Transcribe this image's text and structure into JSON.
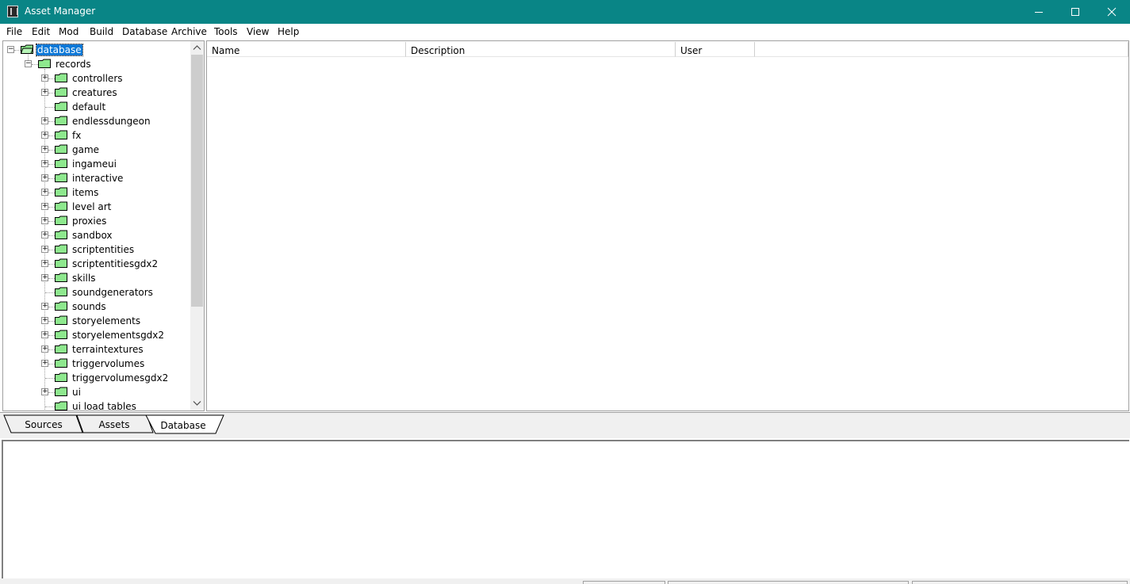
{
  "window": {
    "title": "Asset Manager"
  },
  "menu": [
    "File",
    "Edit",
    "Mod",
    "Build",
    "Database",
    "Archive",
    "Tools",
    "View",
    "Help"
  ],
  "tree": {
    "root": "database",
    "records": "records",
    "children": [
      {
        "label": "controllers",
        "expandable": true
      },
      {
        "label": "creatures",
        "expandable": true
      },
      {
        "label": "default",
        "expandable": false
      },
      {
        "label": "endlessdungeon",
        "expandable": true
      },
      {
        "label": "fx",
        "expandable": true
      },
      {
        "label": "game",
        "expandable": true
      },
      {
        "label": "ingameui",
        "expandable": true
      },
      {
        "label": "interactive",
        "expandable": true
      },
      {
        "label": "items",
        "expandable": true
      },
      {
        "label": "level art",
        "expandable": true
      },
      {
        "label": "proxies",
        "expandable": true
      },
      {
        "label": "sandbox",
        "expandable": true
      },
      {
        "label": "scriptentities",
        "expandable": true
      },
      {
        "label": "scriptentitiesgdx2",
        "expandable": true
      },
      {
        "label": "skills",
        "expandable": true
      },
      {
        "label": "soundgenerators",
        "expandable": false
      },
      {
        "label": "sounds",
        "expandable": true
      },
      {
        "label": "storyelements",
        "expandable": true
      },
      {
        "label": "storyelementsgdx2",
        "expandable": true
      },
      {
        "label": "terraintextures",
        "expandable": true
      },
      {
        "label": "triggervolumes",
        "expandable": true
      },
      {
        "label": "triggervolumesgdx2",
        "expandable": false
      },
      {
        "label": "ui",
        "expandable": true
      },
      {
        "label": "ui load tables",
        "expandable": false
      }
    ]
  },
  "list": {
    "columns": [
      "Name",
      "Description",
      "User"
    ]
  },
  "tabs": [
    {
      "label": "Sources",
      "active": false
    },
    {
      "label": "Assets",
      "active": false
    },
    {
      "label": "Database",
      "active": true
    }
  ],
  "colors": {
    "titlebar": "#098586",
    "folder": "#8ee88e",
    "selection": "#0a78d7"
  }
}
